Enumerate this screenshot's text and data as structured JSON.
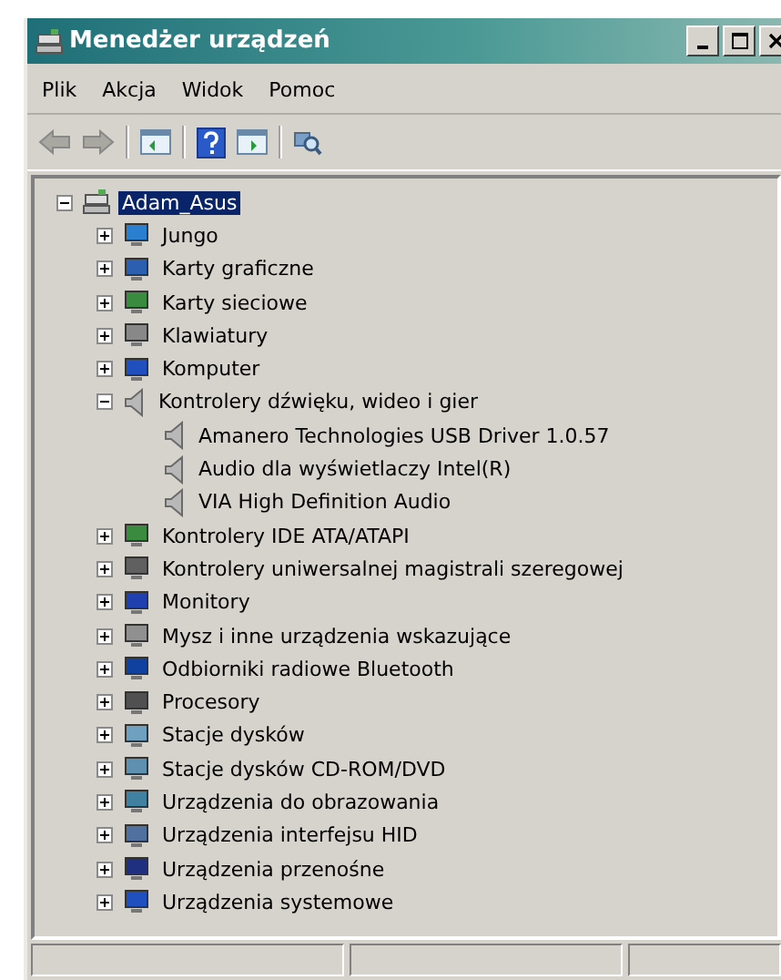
{
  "window": {
    "title": "Menedżer urządzeń"
  },
  "menu": [
    "Plik",
    "Akcja",
    "Widok",
    "Pomoc"
  ],
  "toolbar": [
    {
      "kind": "back"
    },
    {
      "kind": "forward"
    },
    {
      "kind": "separator"
    },
    {
      "kind": "console"
    },
    {
      "kind": "separator"
    },
    {
      "kind": "help"
    },
    {
      "kind": "view"
    },
    {
      "kind": "separator"
    },
    {
      "kind": "scan"
    }
  ],
  "tree": {
    "label": "Adam_Asus",
    "expanded": true,
    "selected": true,
    "children": [
      {
        "label": "Jungo",
        "expanded": false,
        "selected": false
      },
      {
        "label": "Karty graficzne",
        "expanded": false,
        "selected": false
      },
      {
        "label": "Karty sieciowe",
        "expanded": false,
        "selected": false
      },
      {
        "label": "Klawiatury",
        "expanded": false,
        "selected": false
      },
      {
        "label": "Komputer",
        "expanded": false,
        "selected": false
      },
      {
        "label": "Kontrolery dźwięku, wideo i gier",
        "expanded": true,
        "selected": false,
        "children": [
          {
            "label": "Amanero Technologies USB Driver 1.0.57",
            "selected": false
          },
          {
            "label": "Audio dla wyświetlaczy Intel(R)",
            "selected": false
          },
          {
            "label": "VIA High Definition Audio",
            "selected": false
          }
        ]
      },
      {
        "label": "Kontrolery IDE ATA/ATAPI",
        "expanded": false,
        "selected": false
      },
      {
        "label": "Kontrolery uniwersalnej magistrali szeregowej",
        "expanded": false,
        "selected": false
      },
      {
        "label": "Monitory",
        "expanded": false,
        "selected": false
      },
      {
        "label": "Mysz i inne urządzenia wskazujące",
        "expanded": false,
        "selected": false
      },
      {
        "label": "Odbiorniki radiowe Bluetooth",
        "expanded": false,
        "selected": false
      },
      {
        "label": "Procesory",
        "expanded": false,
        "selected": false
      },
      {
        "label": "Stacje dysków",
        "expanded": false,
        "selected": false
      },
      {
        "label": "Stacje dysków CD-ROM/DVD",
        "expanded": false,
        "selected": false
      },
      {
        "label": "Urządzenia do obrazowania",
        "expanded": false,
        "selected": false
      },
      {
        "label": "Urządzenia interfejsu HID",
        "expanded": false,
        "selected": false
      },
      {
        "label": "Urządzenia przenośne",
        "expanded": false,
        "selected": false
      },
      {
        "label": "Urządzenia systemowe",
        "expanded": false,
        "selected": false
      }
    ]
  }
}
